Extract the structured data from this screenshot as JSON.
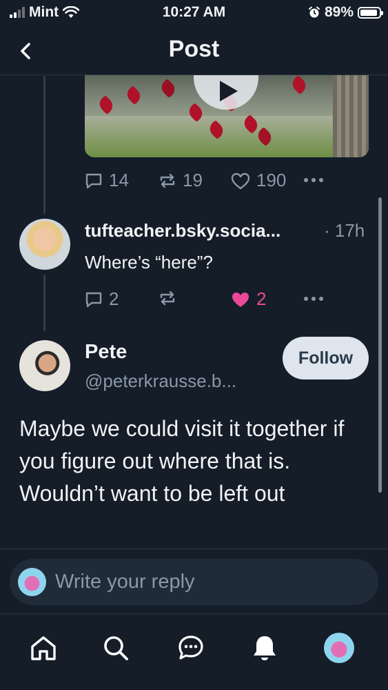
{
  "status_bar": {
    "carrier": "Mint",
    "time": "10:27 AM",
    "battery_percent": "89%",
    "battery_level": 0.89,
    "icons": [
      "signal-icon",
      "wifi-icon",
      "alarm-icon",
      "battery-icon"
    ]
  },
  "header": {
    "title": "Post",
    "back_icon": "chevron-left-icon"
  },
  "parent_post": {
    "media": "video-thumbnail",
    "play_icon": "play-icon",
    "reply_count": "14",
    "repost_count": "19",
    "like_count": "190"
  },
  "reply": {
    "handle": "tufteacher.bsky.socia...",
    "time": "· 17h",
    "text": "Where’s “here”?",
    "reply_count": "2",
    "like_count": "2",
    "liked": true
  },
  "main_post": {
    "name": "Pete",
    "handle": "@peterkrausse.b...",
    "follow_label": "Follow",
    "text": "Maybe we could visit it together if you figure out where that is. Wouldn’t want to be left out"
  },
  "composer": {
    "placeholder": "Write your reply"
  },
  "tab_bar": {
    "items": [
      "home-icon",
      "search-icon",
      "chat-icon",
      "bell-icon",
      "profile-avatar"
    ]
  },
  "colors": {
    "background": "#141d28",
    "like_pink": "#ec4899",
    "muted": "#8b98a8"
  }
}
